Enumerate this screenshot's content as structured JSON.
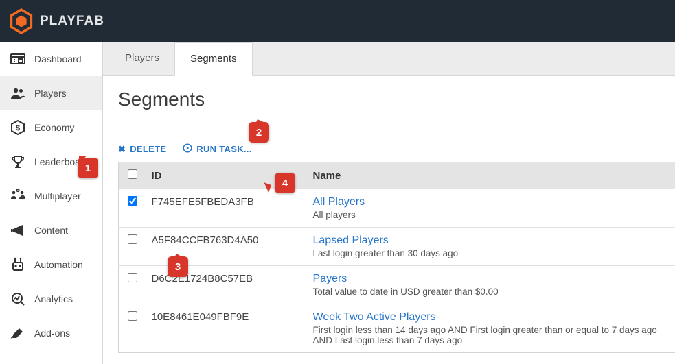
{
  "brand": "PLAYFAB",
  "sidebar": {
    "items": [
      {
        "label": "Dashboard"
      },
      {
        "label": "Players"
      },
      {
        "label": "Economy"
      },
      {
        "label": "Leaderboards"
      },
      {
        "label": "Multiplayer"
      },
      {
        "label": "Content"
      },
      {
        "label": "Automation"
      },
      {
        "label": "Analytics"
      },
      {
        "label": "Add-ons"
      }
    ]
  },
  "tabs": {
    "players": "Players",
    "segments": "Segments"
  },
  "page": {
    "title": "Segments",
    "delete": "DELETE",
    "runtask": "RUN TASK..."
  },
  "table": {
    "head": {
      "id": "ID",
      "name": "Name"
    },
    "rows": [
      {
        "checked": true,
        "id": "F745EFE5FBEDA3FB",
        "name": "All Players",
        "desc": "All players"
      },
      {
        "checked": false,
        "id": "A5F84CCFB763D4A50",
        "name": "Lapsed Players",
        "desc": "Last login greater than 30 days ago"
      },
      {
        "checked": false,
        "id": "D6C2E1724B8C57EB",
        "name": "Payers",
        "desc": "Total value to date in USD greater than $0.00"
      },
      {
        "checked": false,
        "id": "10E8461E049FBF9E",
        "name": "Week Two Active Players",
        "desc": "First login less than 14 days ago AND First login greater than or equal to 7 days ago AND Last login less than 7 days ago"
      }
    ]
  },
  "callouts": {
    "c1": "1",
    "c2": "2",
    "c3": "3",
    "c4": "4"
  }
}
